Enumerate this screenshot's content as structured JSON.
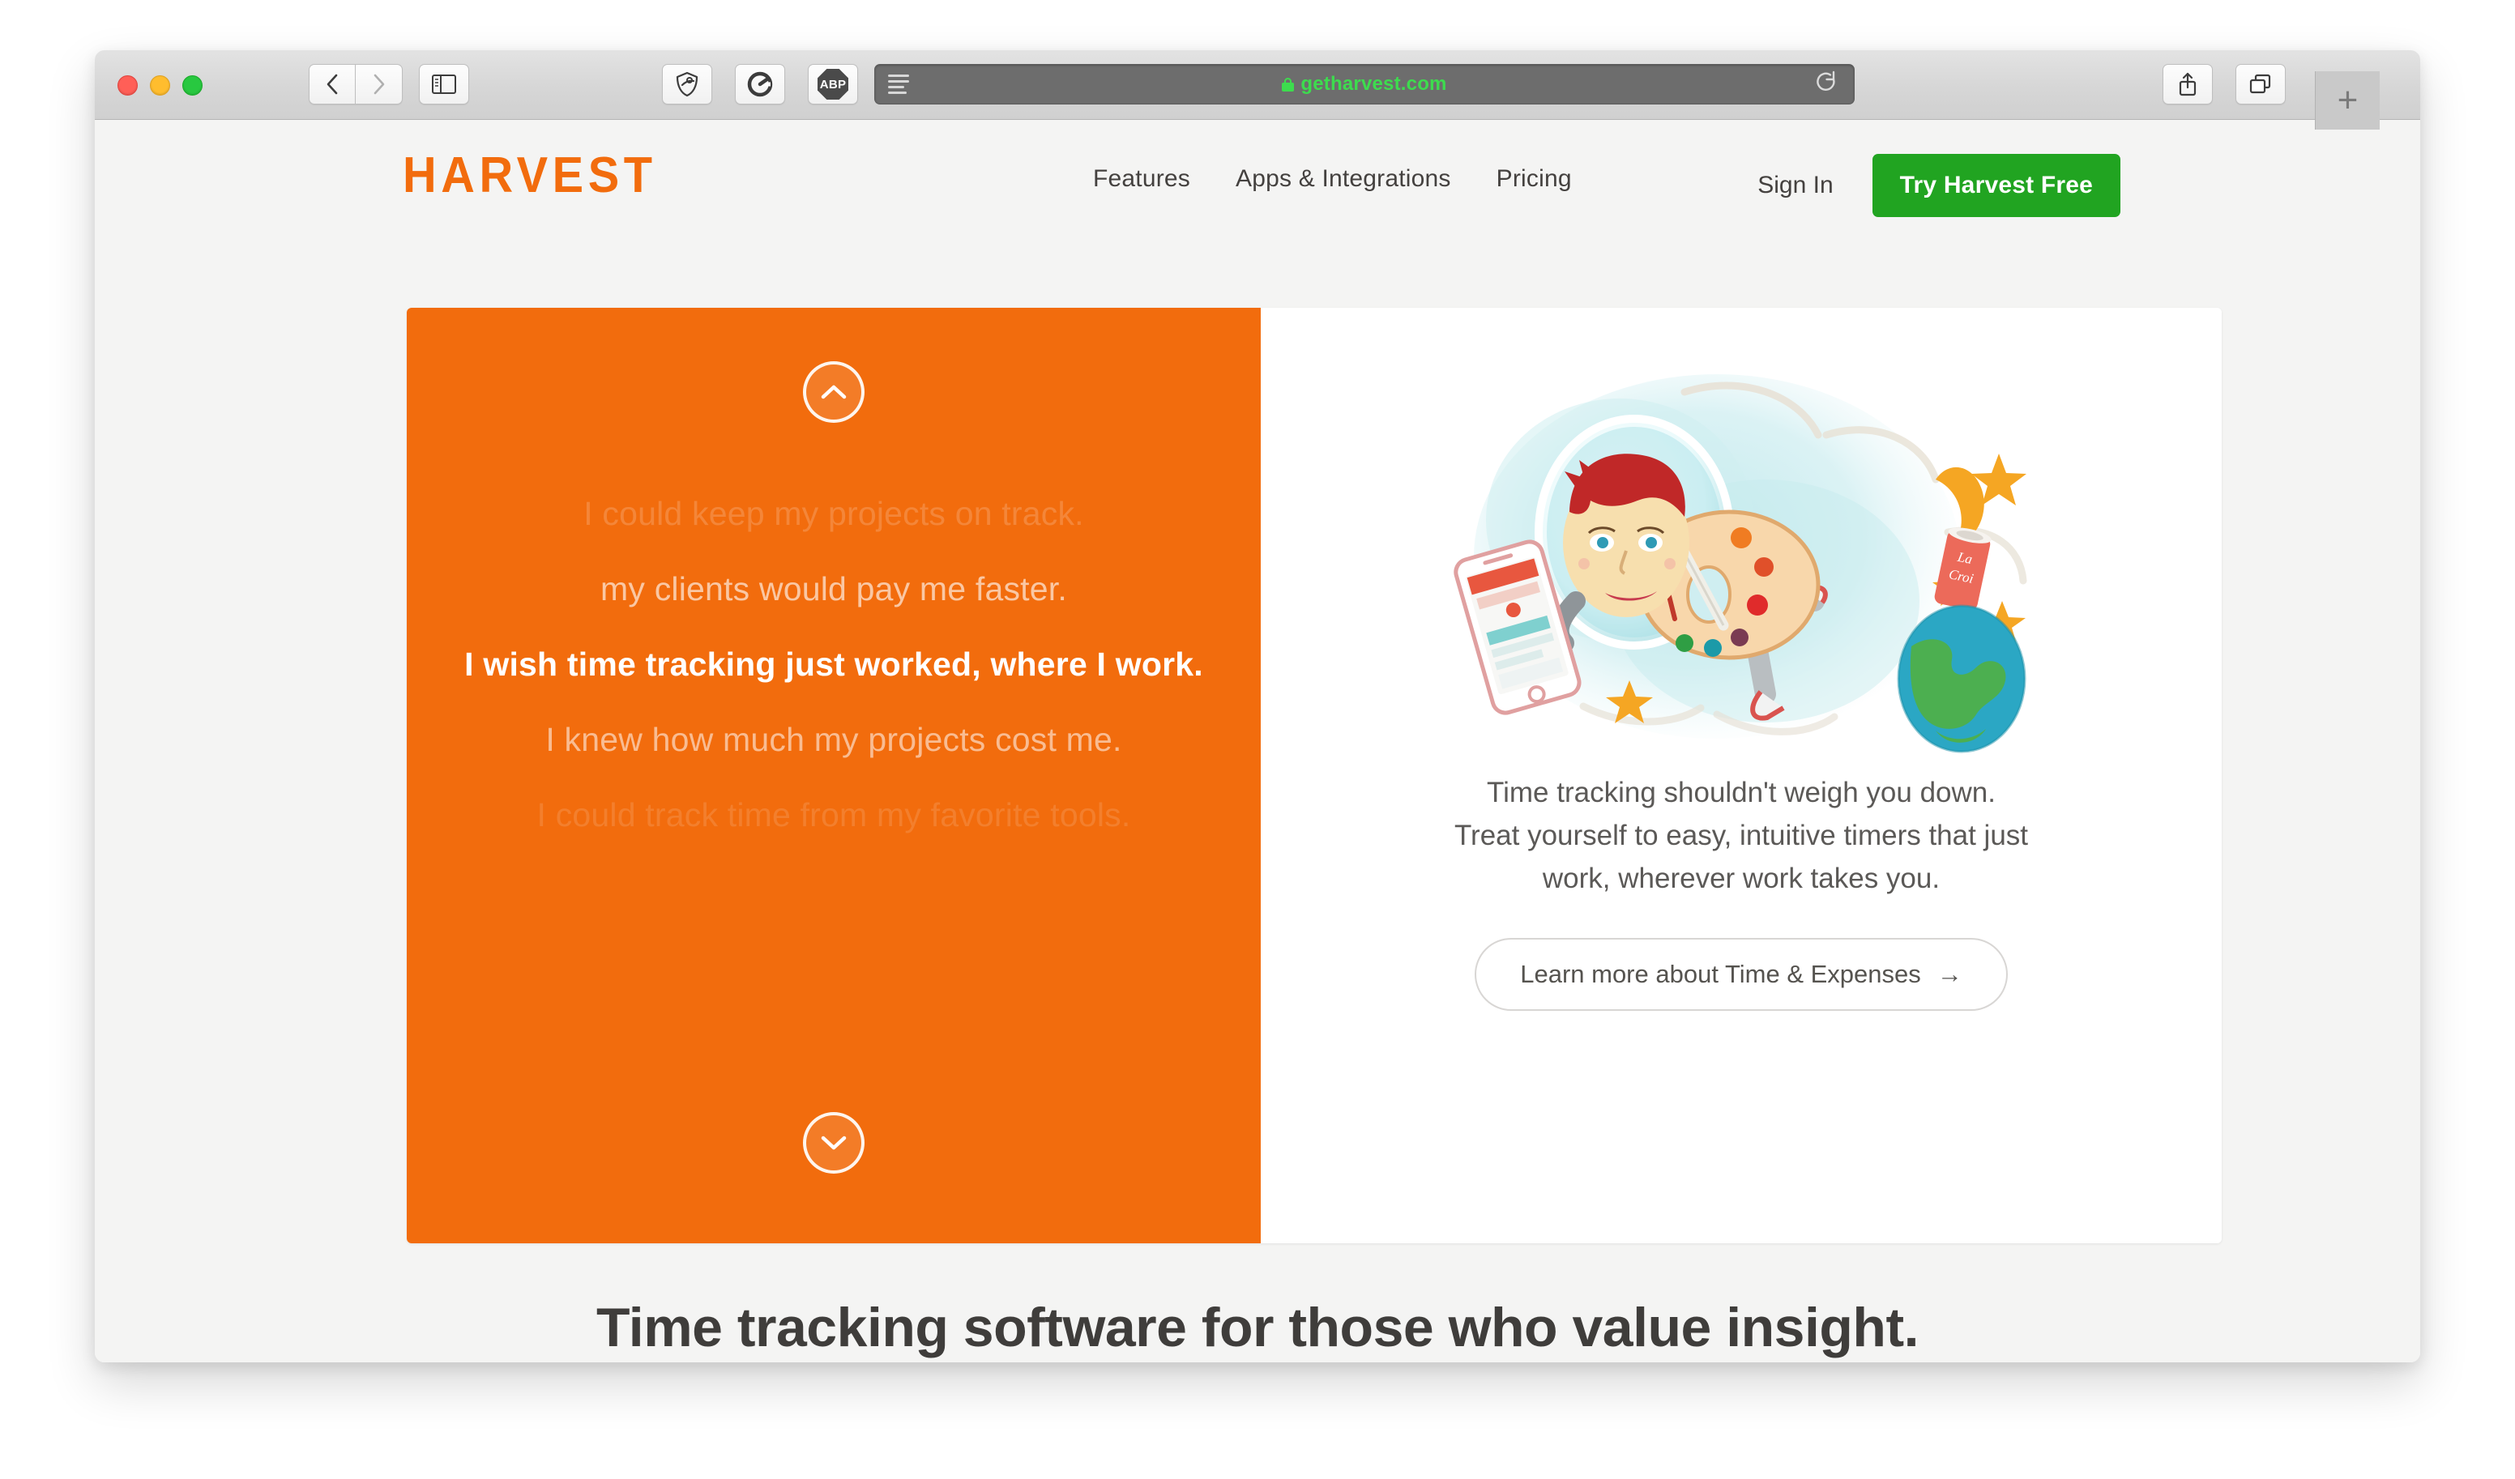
{
  "browser": {
    "url": "getharvest.com",
    "secure_lock": "lock-icon",
    "buttons": {
      "back": "back-icon",
      "forward": "forward-icon",
      "sidebar": "sidebar-icon",
      "share": "share-icon",
      "tabs": "tab-overview-icon",
      "new_tab": "+",
      "reload": "reload-icon",
      "reader": "reader-icon"
    },
    "extensions": [
      {
        "name": "shield-icon",
        "label": ""
      },
      {
        "name": "grammarly-icon",
        "label": "G"
      },
      {
        "name": "adblock-plus-icon",
        "label": "ABP"
      }
    ]
  },
  "site": {
    "logo": "HARVEST",
    "nav": [
      {
        "label": "Features"
      },
      {
        "label": "Apps & Integrations"
      },
      {
        "label": "Pricing"
      }
    ],
    "sign_in": "Sign In",
    "cta": "Try Harvest Free",
    "cta_color": "#21a421",
    "brand_orange": "#f26c0d"
  },
  "hero": {
    "rotator": [
      {
        "text": "I could keep my projects on track.",
        "state": "faded-top"
      },
      {
        "text": "my clients would pay me faster.",
        "state": "dim"
      },
      {
        "text": "I wish time tracking just worked, where I work.",
        "state": "active"
      },
      {
        "text": "I knew how much my projects cost me.",
        "state": "dim"
      },
      {
        "text": "I could track time from my favorite tools.",
        "state": "faded-bottom"
      }
    ],
    "prev_label": "chevron-up-icon",
    "next_label": "chevron-down-icon",
    "illustration": "astronaut-artist-illustration",
    "caption_line1": "Time tracking shouldn't weigh you down.",
    "caption_line2": "Treat yourself to easy, intuitive timers that just",
    "caption_line3": "work, wherever work takes you.",
    "learn_more": "Learn more about Time & Expenses",
    "learn_more_arrow": "→"
  },
  "bottom": {
    "headline": "Time tracking software for those who value insight."
  }
}
